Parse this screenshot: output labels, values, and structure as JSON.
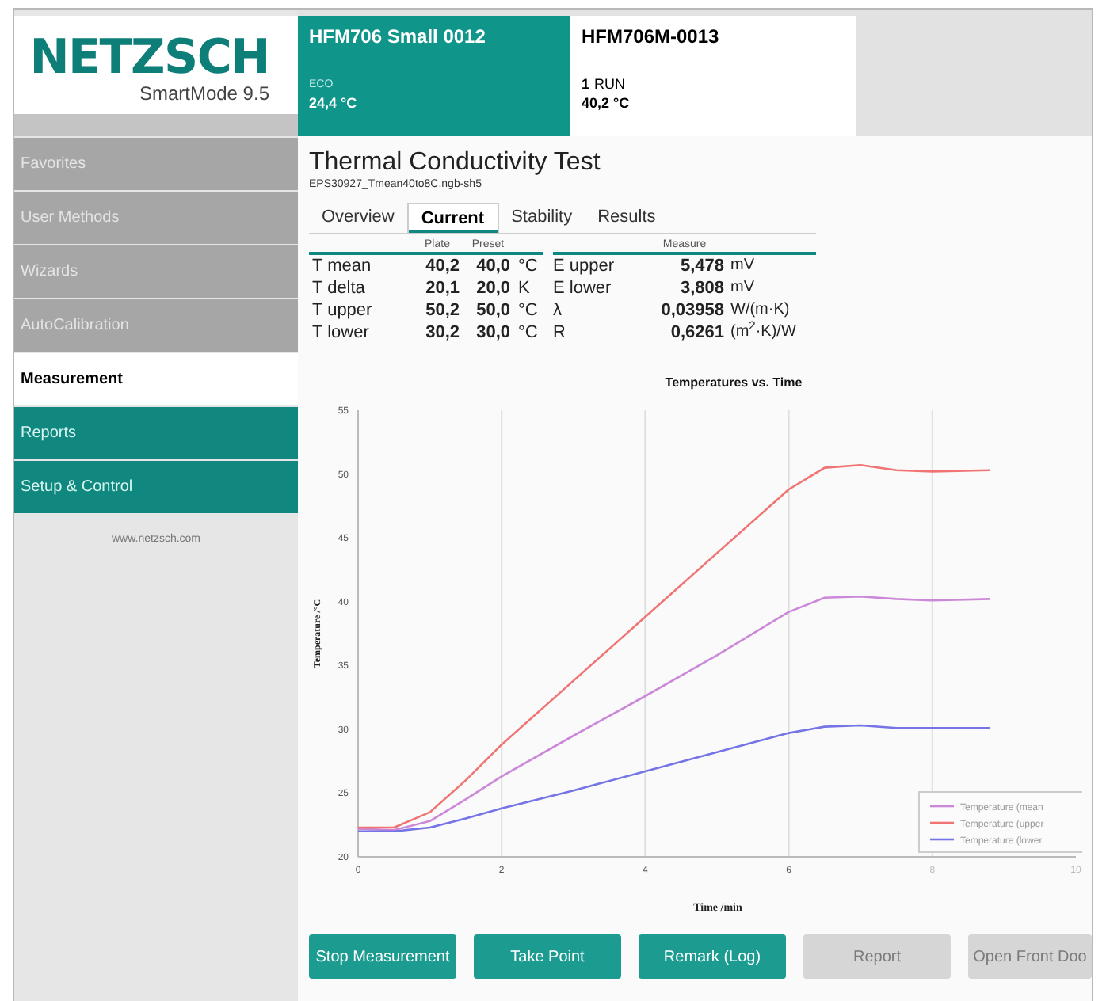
{
  "logo": {
    "brand": "NETZSCH",
    "product": "SmartMode 9.5"
  },
  "instruments": [
    {
      "name": "HFM706 Small 0012",
      "status": "ECO",
      "temperature": "24,4 °C",
      "selected": true
    },
    {
      "name": "HFM706M-0013",
      "count": "1",
      "status": "RUN",
      "temperature": "40,2 °C",
      "selected": false
    }
  ],
  "sidebar": {
    "items": [
      {
        "label": "Favorites",
        "enabled": false,
        "selected": false
      },
      {
        "label": "User Methods",
        "enabled": false,
        "selected": false
      },
      {
        "label": "Wizards",
        "enabled": false,
        "selected": false
      },
      {
        "label": "AutoCalibration",
        "enabled": false,
        "selected": false
      },
      {
        "label": "Measurement",
        "enabled": true,
        "selected": true
      },
      {
        "label": "Reports",
        "enabled": true,
        "selected": false
      },
      {
        "label": "Setup & Control",
        "enabled": true,
        "selected": false
      }
    ],
    "footer": "www.netzsch.com"
  },
  "page": {
    "title": "Thermal Conductivity Test",
    "file": "EPS30927_Tmean40to8C.ngb-sh5"
  },
  "tabs": [
    {
      "label": "Overview",
      "selected": false
    },
    {
      "label": "Current",
      "selected": true
    },
    {
      "label": "Stability",
      "selected": false
    },
    {
      "label": "Results",
      "selected": false
    }
  ],
  "table": {
    "columns": [
      "Plate",
      "Preset",
      "Measure"
    ],
    "rows": [
      {
        "label": "T mean",
        "plate": "40,2",
        "preset": "40,0",
        "unit": "°C",
        "measure_label": "E upper",
        "measure": "5,478",
        "measure_unit": "mV"
      },
      {
        "label": "T delta",
        "plate": "20,1",
        "preset": "20,0",
        "unit": "K",
        "measure_label": "E lower",
        "measure": "3,808",
        "measure_unit": "mV"
      },
      {
        "label": "T upper",
        "plate": "50,2",
        "preset": "50,0",
        "unit": "°C",
        "measure_label": "λ",
        "measure": "0,03958",
        "measure_unit": "W/(m·K)"
      },
      {
        "label": "T lower",
        "plate": "30,2",
        "preset": "30,0",
        "unit": "°C",
        "measure_label": "R",
        "measure": "0,6261",
        "measure_unit": "(m$^{2}$·K)/W"
      }
    ]
  },
  "chart_data": {
    "type": "line",
    "title": "Temperatures vs. Time",
    "xlabel": "Time /min",
    "ylabel": "Temperature /°C",
    "x": [
      0,
      0.5,
      1,
      1.5,
      2,
      3,
      4,
      5,
      6,
      6.5,
      7,
      7.5,
      8,
      8.8
    ],
    "series": [
      {
        "name": "Temperature (mean",
        "color": "#cc88d8",
        "values": [
          22.2,
          22.1,
          22.8,
          24.5,
          26.3,
          29.5,
          32.6,
          35.8,
          39.2,
          40.3,
          40.4,
          40.2,
          40.1,
          40.2
        ]
      },
      {
        "name": "Temperature (upper",
        "color": "#f07474",
        "values": [
          22.3,
          22.3,
          23.5,
          26,
          28.8,
          33.8,
          38.8,
          43.8,
          48.8,
          50.5,
          50.7,
          50.3,
          50.2,
          50.3
        ]
      },
      {
        "name": "Temperature (lower",
        "color": "#7474e6",
        "values": [
          22,
          22,
          22.3,
          23,
          23.8,
          25.2,
          26.7,
          28.2,
          29.7,
          30.2,
          30.3,
          30.1,
          30.1,
          30.1
        ]
      }
    ],
    "grid": true,
    "legend": true,
    "xlim": [
      0,
      10
    ],
    "ylim": [
      20,
      55
    ],
    "xticks": [
      0,
      2,
      4,
      6,
      8,
      10
    ],
    "yticks": [
      20,
      25,
      30,
      35,
      40,
      45,
      50,
      55
    ]
  },
  "buttons": [
    {
      "label": "Stop Measurement",
      "enabled": true
    },
    {
      "label": "Take Point",
      "enabled": true
    },
    {
      "label": "Remark (Log)",
      "enabled": true
    },
    {
      "label": "Report",
      "enabled": false
    },
    {
      "label": "Open Front Doo",
      "enabled": false
    }
  ]
}
